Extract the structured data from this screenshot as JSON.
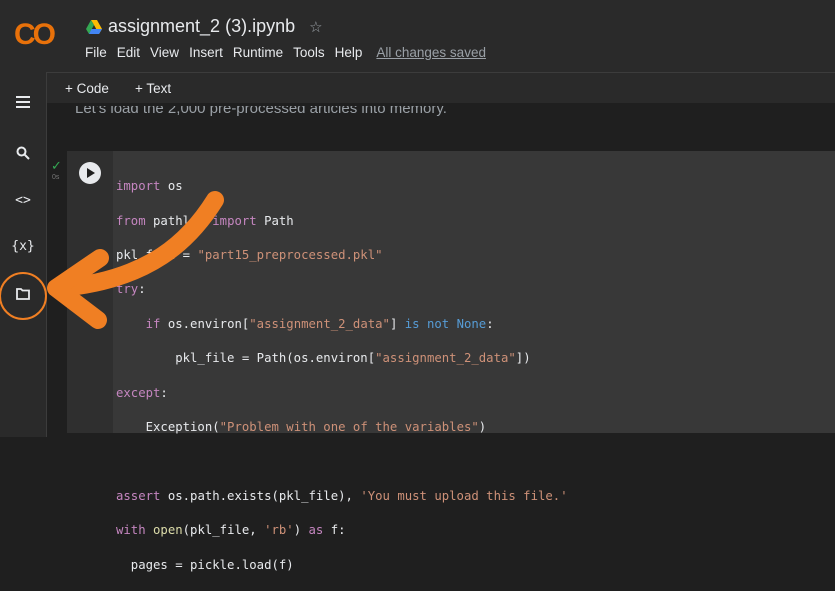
{
  "logo": {
    "text": "CO"
  },
  "header": {
    "title": "assignment_2 (3).ipynb",
    "star_glyph": "☆",
    "menu": [
      "File",
      "Edit",
      "View",
      "Insert",
      "Runtime",
      "Tools",
      "Help"
    ],
    "save_status": "All changes saved"
  },
  "toolbar": {
    "add_code": "+ Code",
    "add_text": "+ Text"
  },
  "sidebar": {
    "icons": [
      "table-of-contents-icon",
      "search-icon",
      "code-snippets-icon",
      "variables-icon",
      "files-icon"
    ],
    "code_glyph": "<>",
    "variables_glyph": "{x}"
  },
  "text_cell": {
    "text": "Let's load the 2,000 pre-processed articles into memory."
  },
  "code_cell": {
    "status_glyph": "✓",
    "exec_label": "0s",
    "lines": [
      "import os",
      "from pathlib import Path",
      "pkl_file = \"part15_preprocessed.pkl\"",
      "try:",
      "    if os.environ[\"assignment_2_data\"] is not None:",
      "        pkl_file = Path(os.environ[\"assignment_2_data\"])",
      "except:",
      "    Exception(\"Problem with one of the variables\")",
      "",
      "assert os.path.exists(pkl_file), 'You must upload this file.'",
      "with open(pkl_file, 'rb') as f:",
      "  pages = pickle.load(f)"
    ]
  },
  "colors": {
    "annotation": "#f07f23",
    "logo_orange": "#e8710a",
    "logo_yellow": "#f9ab00"
  }
}
